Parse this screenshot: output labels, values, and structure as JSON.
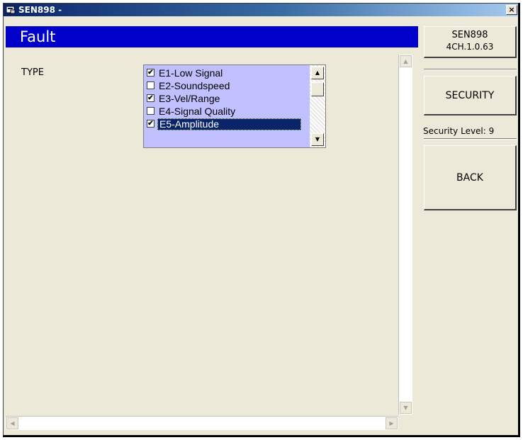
{
  "window": {
    "title": "SEN898 -",
    "close_label": "×"
  },
  "header": {
    "title": "Fault"
  },
  "content": {
    "type_label": "TYPE",
    "fault_list": {
      "items": [
        {
          "label": "E1-Low Signal",
          "checked": true,
          "selected": false
        },
        {
          "label": "E2-Soundspeed",
          "checked": false,
          "selected": false
        },
        {
          "label": "E3-Vel/Range",
          "checked": true,
          "selected": false
        },
        {
          "label": "E4-Signal Quality",
          "checked": false,
          "selected": false
        },
        {
          "label": "E5-Amplitude",
          "checked": true,
          "selected": true
        }
      ],
      "scroll_up": "▲",
      "scroll_down": "▼"
    }
  },
  "scrollbars": {
    "v_up": "▲",
    "v_down": "▼",
    "h_left": "◀",
    "h_right": "▶"
  },
  "sidebar": {
    "version_line1": "SEN898",
    "version_line2": "4CH.1.0.63",
    "security_button": "SECURITY",
    "security_level": "Security Level: 9",
    "back_button": "BACK"
  },
  "colors": {
    "header_bg": "#0000c8",
    "list_bg": "#c0c0ff",
    "selection_bg": "#0a246a",
    "window_bg": "#ece9d8"
  }
}
